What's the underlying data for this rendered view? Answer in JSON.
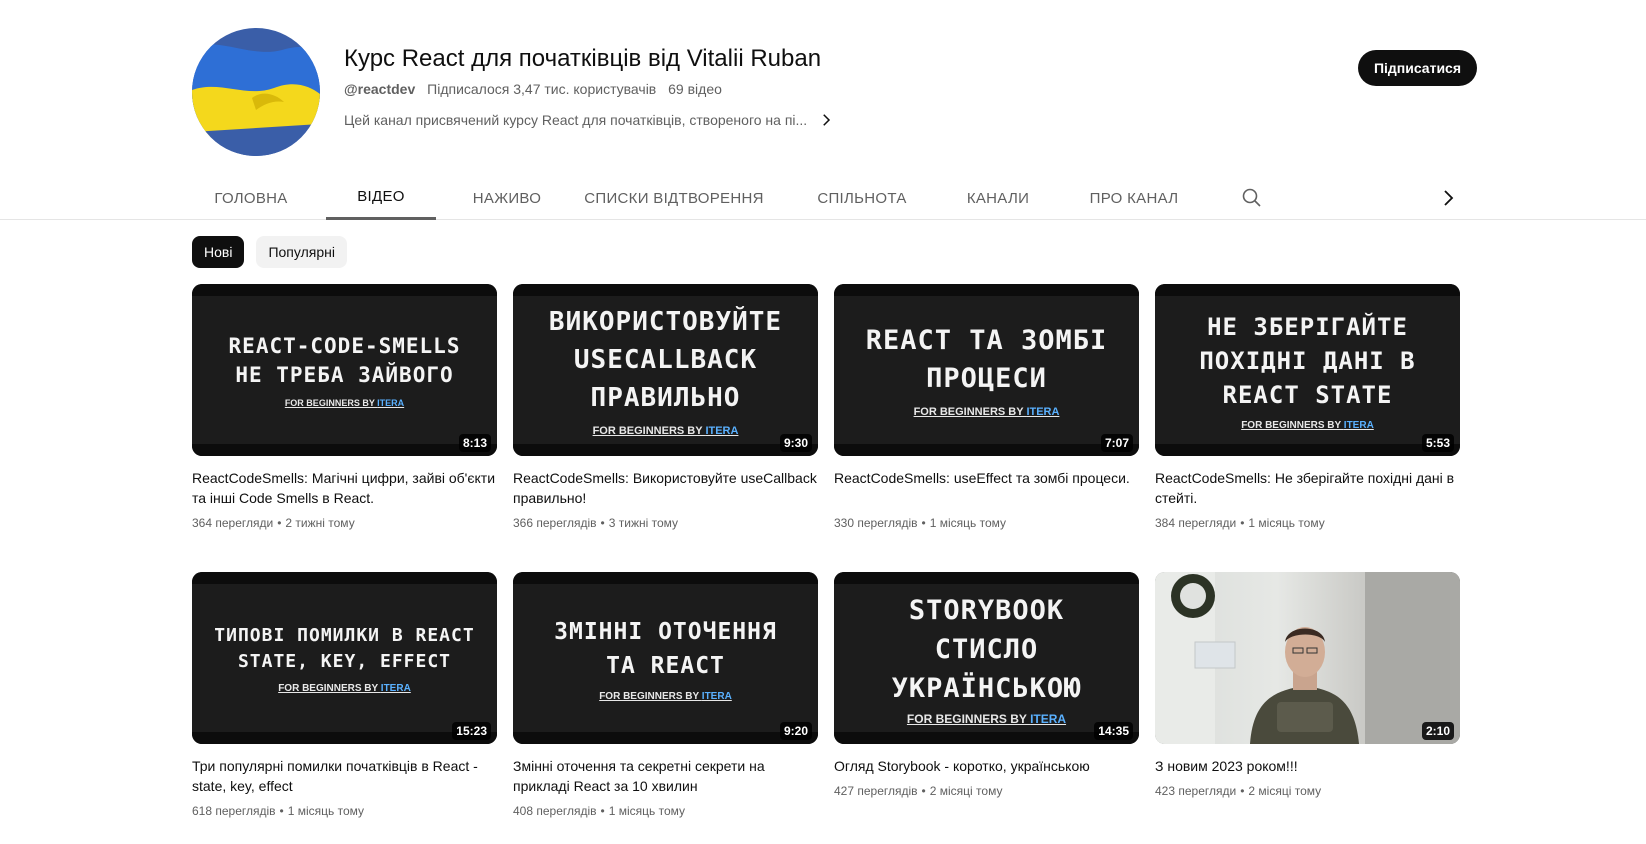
{
  "channel": {
    "title": "Курс React для початківців від Vitalii Ruban",
    "handle": "@reactdev",
    "subscribers": "Підписалося 3,47 тис. користувачів",
    "videos_count": "69 відео",
    "description": "Цей канал присвячений курсу React для початківців, створеного на пі...",
    "subscribe_label": "Підписатися"
  },
  "tabs": [
    "ГОЛОВНА",
    "ВІДЕО",
    "НАЖИВО",
    "СПИСКИ ВІДТВОРЕННЯ",
    "СПІЛЬНОТА",
    "КАНАЛИ",
    "ПРО КАНАЛ"
  ],
  "active_tab": "ВІДЕО",
  "chips": [
    "Нові",
    "Популярні"
  ],
  "active_chip": "Нові",
  "thumb_brand": {
    "prefix": "FOR BEGINNERS BY ",
    "brand": "ITERA"
  },
  "videos": [
    {
      "thumb_text": "REACT-CODE-SMELLS\nНЕ ТРЕБА ЗАЙВОГО",
      "duration": "8:13",
      "title": "ReactCodeSmells: Магічні цифри, зайві об'єкти та інші Code Smells в React.",
      "views": "364 перегляди",
      "age": "2 тижні тому"
    },
    {
      "thumb_text": "ВИКОРИСТОВУЙТЕ\nUSECALLBACK\nПРАВИЛЬНО",
      "duration": "9:30",
      "title": "ReactCodeSmells: Використовуйте useCallback правильно!",
      "views": "366 переглядів",
      "age": "3 тижні тому"
    },
    {
      "thumb_text": "REACT ТА ЗОМБІ\nПРОЦЕСИ",
      "duration": "7:07",
      "title": "ReactCodeSmells: useEffect та зомбі процеси.",
      "views": "330 переглядів",
      "age": "1 місяць тому"
    },
    {
      "thumb_text": "НЕ ЗБЕРІГАЙТЕ\nПОХІДНІ ДАНІ В\nREACT STATE",
      "duration": "5:53",
      "title": "ReactCodeSmells: Не зберігайте похідні дані в стейті.",
      "views": "384 перегляди",
      "age": "1 місяць тому"
    },
    {
      "thumb_text": "ТИПОВІ ПОМИЛКИ В REACT\nSTATE, KEY, EFFECT",
      "duration": "15:23",
      "title": "Три популярні помилки початківців в React - state, key, effect",
      "views": "618 переглядів",
      "age": "1 місяць тому"
    },
    {
      "thumb_text": "ЗМІННІ ОТОЧЕННЯ\nТА REACT",
      "duration": "9:20",
      "title": "Змінні оточення та секретні секрети на прикладі React за 10 хвилин",
      "views": "408 переглядів",
      "age": "1 місяць тому"
    },
    {
      "thumb_text": "STORYBOOK\nСТИСЛО\nУКРАЇНСЬКОЮ",
      "duration": "14:35",
      "title": "Огляд Storybook - коротко, українською",
      "views": "427 переглядів",
      "age": "2 місяці тому"
    },
    {
      "thumb_text": "",
      "duration": "2:10",
      "title": "З новим 2023 роком!!!",
      "views": "423 перегляди",
      "age": "2 місяці тому"
    }
  ],
  "colors": {
    "accent": "#0f0f0f",
    "muted": "#606060",
    "brand_link": "#5ab1ff",
    "flag_blue": "#3a5ea8",
    "flag_yellow": "#f4d81c"
  }
}
